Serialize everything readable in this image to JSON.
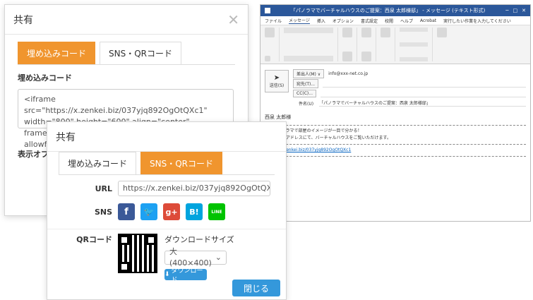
{
  "dialog_back": {
    "title": "共有",
    "tabs": [
      "埋め込みコード",
      "SNS・QRコード"
    ],
    "section_label": "埋め込みコード",
    "embed_code": "<iframe src=\"https://x.zenkei.biz/037yjq892OgOtQXc1\" width=\"800\" height=\"600\" align=\"center\" frameBorder=\"0\" scrolling=\"no\" allowfullscreen=\"true\"></iframe>",
    "options_label": "表示オプシ",
    "close_symbol": "✕"
  },
  "dialog_front": {
    "title": "共有",
    "tabs": [
      "埋め込みコード",
      "SNS・QRコード"
    ],
    "url_label": "URL",
    "url_value": "https://x.zenkei.biz/037yjq892OgOtQXc1",
    "sns_label": "SNS",
    "sns": [
      {
        "name": "facebook",
        "glyph": "f",
        "color": "#3b5998"
      },
      {
        "name": "twitter",
        "glyph": "🐦",
        "color": "#1da1f2"
      },
      {
        "name": "google-plus",
        "glyph": "g+",
        "color": "#dd4b39"
      },
      {
        "name": "hatena",
        "glyph": "B!",
        "color": "#00a4de"
      },
      {
        "name": "line",
        "glyph": "LINE",
        "color": "#00c300"
      }
    ],
    "qr_label": "QRコード",
    "download_size_label": "ダウンロードサイズ",
    "size_option": "大 (400×400)",
    "download_button": "ダウンロード",
    "close_button": "閉じる"
  },
  "outlook": {
    "title": "「パノラマでバーチャルハウスのご提案：西泉 太郎様邸」 - メッセージ (テキスト形式)",
    "menu": [
      "ファイル",
      "メッセージ",
      "挿入",
      "オプション",
      "書式設定",
      "校閲",
      "ヘルプ",
      "Acrobat",
      "実行したい作業を入力してください"
    ],
    "from_button": "差出人(M) ∨",
    "from_value": "info@xxx-net.co.jp",
    "send_button": "送信(S)",
    "to_button": "宛先(T)...",
    "cc_button": "CC(C)...",
    "subject_label": "件名(U)",
    "subject_value": "「パノラマでバーチャルハウスのご提案：西泉 太郎様邸」",
    "body_greeting": "西泉 太郎様",
    "body_line1": "360度パノラマで部屋のイメージが一目で分かる！",
    "body_line2": "下記のURLアドレスにて、バーチャルハウスをご覧いただけます。",
    "body_link": "https://x.zenkei.biz/037yjq892OgOtQXc1"
  }
}
